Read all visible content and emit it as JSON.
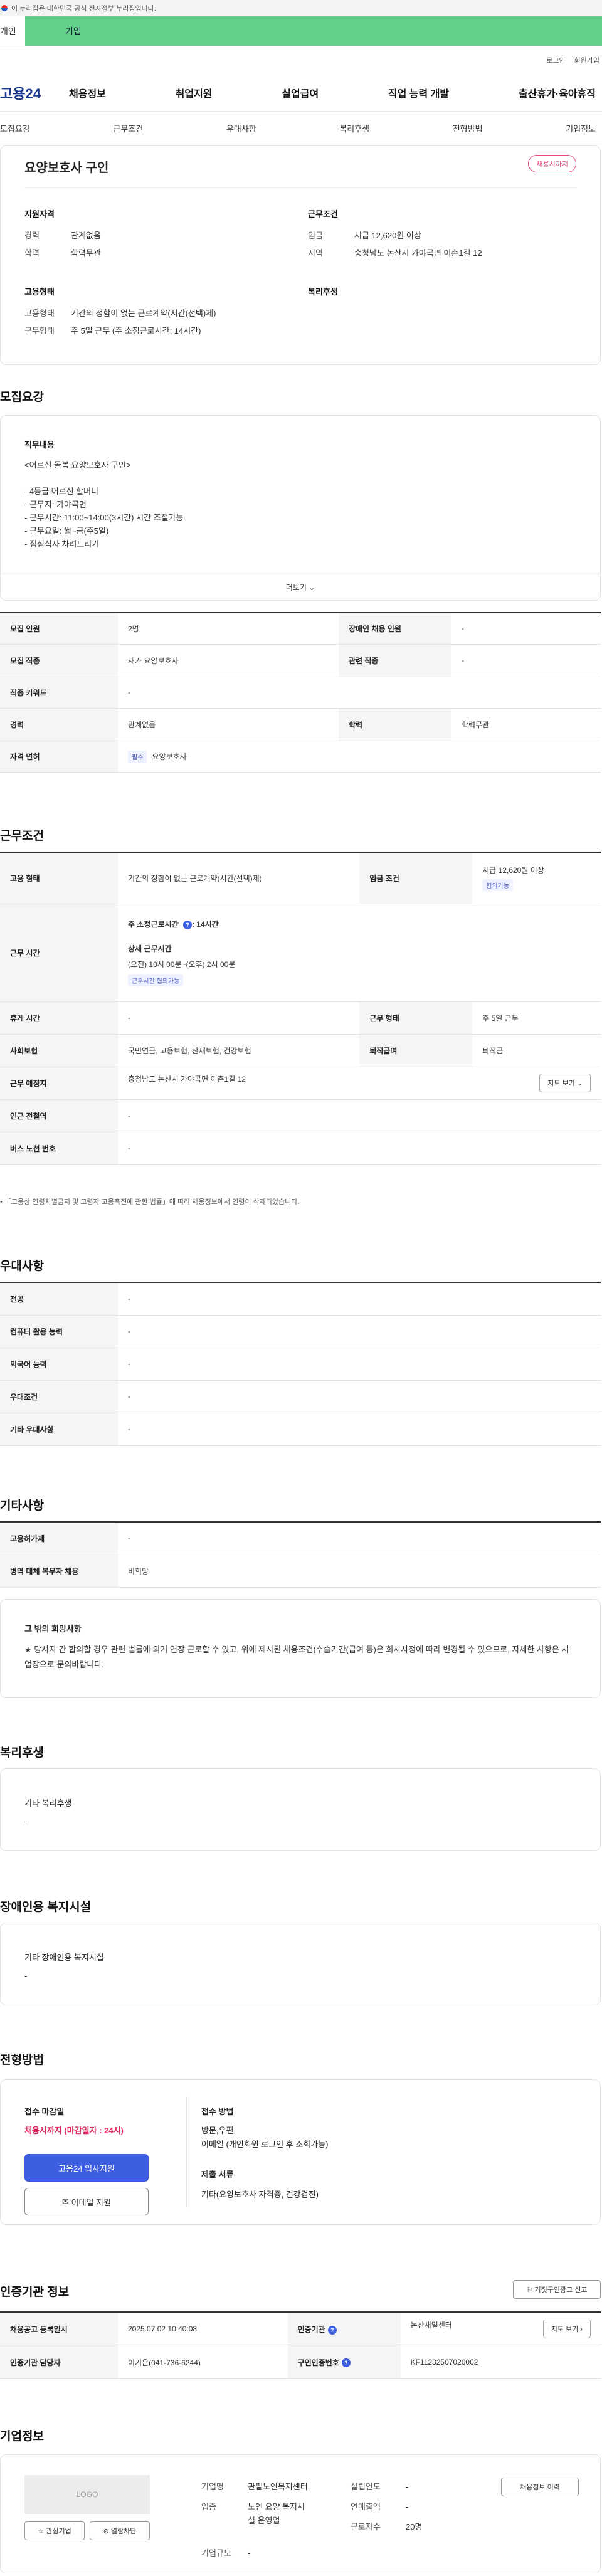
{
  "gov_banner": "이 누리집은 대한민국 공식 전자정부 누리집입니다.",
  "tabs": {
    "person": "개인",
    "company": "기업"
  },
  "util": {
    "login": "로그인",
    "join": "회원가입"
  },
  "logo": "고용24",
  "main_nav": [
    "채용정보",
    "취업지원",
    "실업급여",
    "직업 능력 개발",
    "출산휴가·육아휴직"
  ],
  "sub_nav": [
    "모집요강",
    "근무조건",
    "우대사항",
    "복리후생",
    "전형방법",
    "기업정보"
  ],
  "summary": {
    "title": "요양보호사 구인",
    "status_badge": "채용시까지",
    "qualification_h": "지원자격",
    "career_k": "경력",
    "career_v": "관계없음",
    "edu_k": "학력",
    "edu_v": "학력무관",
    "conditions_h": "근무조건",
    "wage_k": "임금",
    "wage_v": "시급 12,620원 이상",
    "region_k": "지역",
    "region_v": "충청남도 논산시 가야곡면 이촌1길 12",
    "emp_type_h": "고용형태",
    "emp_k": "고용형태",
    "emp_v": "기간의 정함이 없는 근로계약(시간(선택)제)",
    "work_k": "근무형태",
    "work_v": "주 5일 근무 (주 소정근로시간: 14시간)",
    "welfare_h": "복리후생"
  },
  "recruit": {
    "section_title": "모집요강",
    "duty_h": "직무내용",
    "duty_lines": [
      "<어르신 돌봄 요양보호사 구인>",
      "",
      "- 4등급 어르신 할머니",
      "- 근무지: 가야곡면",
      "- 근무시간: 11:00~14:00(3시간) 시간 조절가능",
      "- 근무요일: 월~금(주5일)",
      "- 점심식사 차려드리기"
    ],
    "more_label": "더보기"
  },
  "recruit_table": {
    "headcount_k": "모집 인원",
    "headcount_v": "2명",
    "disabled_k": "장애인 채용 인원",
    "disabled_v": "-",
    "job_k": "모집 직종",
    "job_v": "재가 요양보호사",
    "related_k": "관련 직종",
    "related_v": "-",
    "keyword_k": "직종 키워드",
    "keyword_v": "-",
    "career_k": "경력",
    "career_v": "관계없음",
    "edu_k": "학력",
    "edu_v": "학력무관",
    "license_k": "자격 면허",
    "license_badge": "필수",
    "license_v": "요양보호사"
  },
  "conditions": {
    "section_title": "근무조건",
    "emp_k": "고용 형태",
    "emp_v": "기간의 정함이 없는 근로계약(시간(선택)제)",
    "wage_k": "임금 조건",
    "wage_v": "시급 12,620원 이상",
    "wage_badge": "협의가능",
    "hours_k": "근무 시간",
    "hours_total": "주 소정근로시간",
    "hours_total_v": ": 14시간",
    "hours_detail_h": "상세 근무시간",
    "hours_detail_v": "(오전) 10시 00분~(오후) 2시 00분",
    "hours_badge": "근무시간 협의가능",
    "rest_k": "휴게 시간",
    "rest_v": "-",
    "form_k": "근무 형태",
    "form_v": "주 5일 근무",
    "insurance_k": "사회보험",
    "insurance_v": "국민연금, 고용보험, 산재보험, 건강보험",
    "retire_k": "퇴직급여",
    "retire_v": "퇴직금",
    "place_k": "근무 예정지",
    "place_v": "충청남도 논산시 가야곡면 이촌1길 12",
    "map_label": "지도 보기",
    "subway_k": "인근 전철역",
    "subway_v": "-",
    "bus_k": "버스 노선 번호",
    "bus_v": "-",
    "note": "「고용상 연령차별금지 및 고령자 고용촉진에 관한 법률」에 따라 채용정보에서 연령이 삭제되었습니다."
  },
  "preference": {
    "section_title": "우대사항",
    "rows": [
      {
        "k": "전공",
        "v": "-"
      },
      {
        "k": "컴퓨터 활용 능력",
        "v": "-"
      },
      {
        "k": "외국어 능력",
        "v": "-"
      },
      {
        "k": "우대조건",
        "v": "-"
      },
      {
        "k": "기타 우대사항",
        "v": "-"
      }
    ]
  },
  "etc": {
    "section_title": "기타사항",
    "rows": [
      {
        "k": "고용허가제",
        "v": "-"
      },
      {
        "k": "병역 대체 복무자 채용",
        "v": "비희망"
      }
    ],
    "other_h": "그 밖의 희망사항",
    "other_text": "★ 당사자 간 합의할 경우 관련 법률에 의거 연장 근로할 수 있고, 위에 제시된 채용조건(수습기간(급여 등)은 회사사정에 따라 변경될 수 있으므로, 자세한 사항은 사업장으로 문의바랍니다."
  },
  "welfare": {
    "section_title": "복리후생",
    "h": "기타 복리후생",
    "v": "-"
  },
  "facility": {
    "section_title": "장애인용 복지시설",
    "h": "기타 장애인용 복지시설",
    "v": "-"
  },
  "selection": {
    "section_title": "전형방법",
    "deadline_h": "접수 마감일",
    "deadline_v": "채용시까지 (마감일자 : 24시)",
    "apply_btn": "고용24 입사지원",
    "email_btn": "이메일 지원",
    "method_h": "접수 방법",
    "method_v1": "방문,우편,",
    "method_v2": "이메일 (개인회원 로그인 후 조회가능)",
    "docs_h": "제출 서류",
    "docs_v": "기타(요양보호사 자격증, 건강검진)"
  },
  "cert": {
    "section_title": "인증기관 정보",
    "report_btn": "거짓구인광고 신고",
    "reg_k": "채용공고 등록일시",
    "reg_v": "2025.07.02 10:40:08",
    "agency_k": "인증기관",
    "agency_v": "논산새일센터",
    "map_label": "지도 보기",
    "manager_k": "인증기관 담당자",
    "manager_v": "이기은(041-736-6244)",
    "num_k": "구인인증번호",
    "num_v": "KF11232507020002"
  },
  "company": {
    "section_title": "기업정보",
    "logo_text": "LOGO",
    "fav_btn": "관심기업",
    "block_btn": "열람차단",
    "name_k": "기업명",
    "name_v": "관필노인복지센터",
    "industry_k": "업종",
    "industry_v1": "노인 요양 복지시",
    "industry_v2": "설 운영업",
    "scale_k": "기업규모",
    "scale_v": "-",
    "founded_k": "설립연도",
    "founded_v": "-",
    "sales_k": "연매출액",
    "sales_v": "-",
    "staff_k": "근로자수",
    "staff_v": "20명",
    "history_btn": "채용정보 이력"
  }
}
